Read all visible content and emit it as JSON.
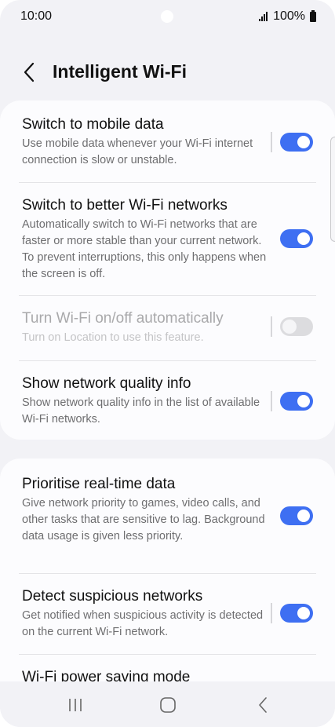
{
  "status_bar": {
    "time": "10:00",
    "battery": "100%",
    "icons": [
      "signal-icon",
      "battery-icon"
    ]
  },
  "header": {
    "title": "Intelligent Wi-Fi",
    "back_icon": "chevron-left-icon"
  },
  "settings_group_1": [
    {
      "title": "Switch to mobile data",
      "description": "Use mobile data whenever your Wi-Fi internet connection is slow or unstable.",
      "enabled": true,
      "toggle": "on"
    },
    {
      "title": "Switch to better Wi-Fi networks",
      "description": "Automatically switch to Wi-Fi networks that are faster or more stable than your current network. To prevent interruptions, this only happens when the screen is off.",
      "enabled": true,
      "toggle": "on"
    },
    {
      "title": "Turn Wi-Fi on/off automatically",
      "description": "Turn on Location to use this feature.",
      "enabled": false,
      "toggle": "off"
    },
    {
      "title": "Show network quality info",
      "description": "Show network quality info in the list of available Wi-Fi networks.",
      "enabled": true,
      "toggle": "on"
    }
  ],
  "settings_group_2": [
    {
      "title": "Prioritise real-time data",
      "description": "Give network priority to games, video calls, and other tasks that are sensitive to lag. Background data usage is given less priority.",
      "enabled": true,
      "toggle": "on"
    },
    {
      "title": "Detect suspicious networks",
      "description": "Get notified when suspicious activity is detected on the current Wi-Fi network.",
      "enabled": true,
      "toggle": "on"
    },
    {
      "title": "Wi-Fi power saving mode"
    }
  ],
  "nav_bar": {
    "buttons": [
      "recent-apps-icon",
      "home-icon",
      "back-icon"
    ]
  },
  "colors": {
    "accent": "#3e6ff2",
    "background": "#f2f2f6",
    "card": "#fcfcfe"
  }
}
